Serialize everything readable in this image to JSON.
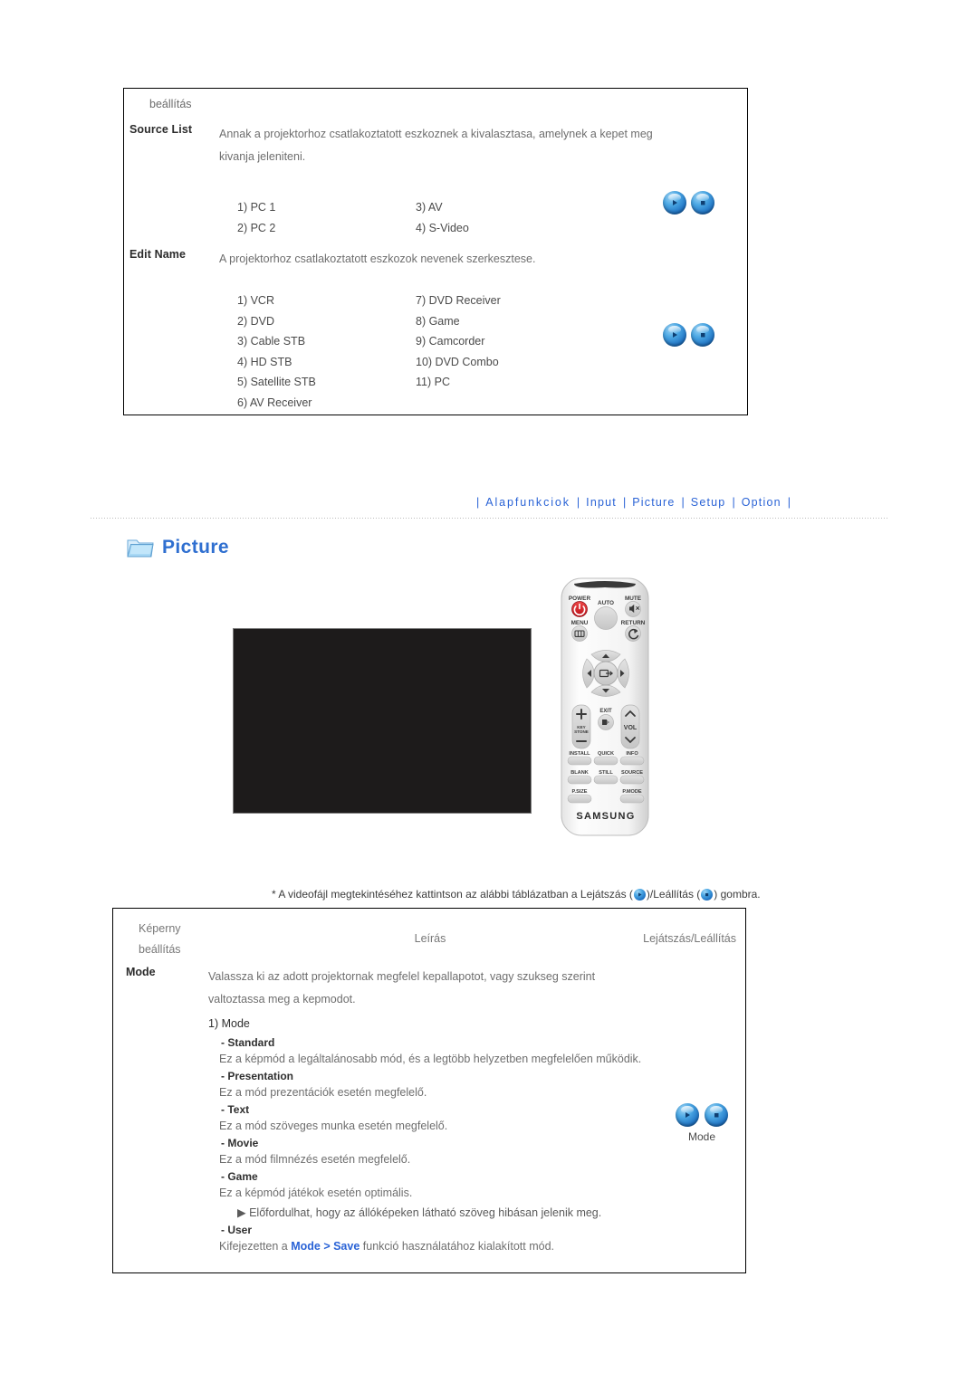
{
  "top_table": {
    "column_header": "beállítás",
    "rows": [
      {
        "label": "Source List",
        "description": "Annak a projektorhoz csatlakoztatott eszkoznek a kivalasztasa, amelynek a kepet meg kivanja jeleniteni.",
        "options_left": [
          "1) PC 1",
          "2) PC 2"
        ],
        "options_right": [
          "3) AV",
          "4) S-Video"
        ]
      },
      {
        "label": "Edit Name",
        "description": "A projektorhoz csatlakoztatott eszkozok nevenek szerkesztese.",
        "options_left": [
          "1) VCR",
          "2) DVD",
          "3) Cable STB",
          "4) HD STB",
          "5) Satellite STB",
          "6) AV Receiver"
        ],
        "options_right": [
          "7) DVD Receiver",
          "8) Game",
          "9) Camcorder",
          "10) DVD Combo",
          "11) PC"
        ]
      }
    ]
  },
  "nav": {
    "items": [
      {
        "label": "Alapfunkciok"
      },
      {
        "label": "Input"
      },
      {
        "label": "Picture"
      },
      {
        "label": "Setup"
      },
      {
        "label": "Option"
      }
    ],
    "separator": "|",
    "color": "#2a63d6"
  },
  "section": {
    "icon": "folder-icon",
    "title": "Picture"
  },
  "remote": {
    "brand": "SAMSUNG",
    "buttons": {
      "power": "POWER",
      "auto": "AUTO",
      "mute": "MUTE",
      "menu": "MENU",
      "return": "RETURN",
      "exit": "EXIT",
      "vol": "VOL",
      "install": "INSTALL",
      "quick": "QUICK",
      "info": "INFO",
      "blank": "BLANK",
      "still": "STILL",
      "source": "SOURCE",
      "psize": "P.SIZE",
      "pmode": "P.MODE"
    }
  },
  "caption": {
    "prefix": "* A videofájl megtekintéséhez kattintson az alábbi táblázatban a Lejátszás (",
    "middle": ")/Leállítás (",
    "suffix": ") gombra."
  },
  "bottom_table": {
    "headers": {
      "left": "Képerny beállítás",
      "left_line1": "Képerny",
      "left_line2": "beállítás",
      "middle": "Leírás",
      "right": "Lejátszás/Leállítás"
    },
    "row": {
      "label": "Mode",
      "description": "Valassza ki az adott projektornak megfelel kepallapotot, vagy szukseg szerint valtoztassa meg a kepmodot.",
      "list_title": "1) Mode",
      "items": [
        {
          "name": "- Standard",
          "body": "Ez a képmód a legáltalánosabb mód, és a legtöbb helyzetben megfelelően működik."
        },
        {
          "name": "- Presentation",
          "body": "Ez a mód prezentációk esetén megfelelő."
        },
        {
          "name": "- Text",
          "body": "Ez a mód szöveges munka esetén megfelelő."
        },
        {
          "name": "- Movie",
          "body": "Ez a mód filmnézés esetén megfelelő."
        },
        {
          "name": "- Game",
          "body": "Ez a képmód játékok esetén optimális.",
          "note": "▶ Előfordulhat, hogy az állóképeken látható szöveg hibásan jelenik meg."
        },
        {
          "name": "- User",
          "body_before": "Kifejezetten a ",
          "body_link": "Mode > Save",
          "body_after": " funkció használatához kialakított mód."
        }
      ],
      "buttons_caption": "Mode"
    }
  },
  "colors": {
    "link_blue": "#2a63d6",
    "title_blue": "#2f6fd0",
    "video_black": "#1d1b1b",
    "power_red": "#d8202a"
  }
}
